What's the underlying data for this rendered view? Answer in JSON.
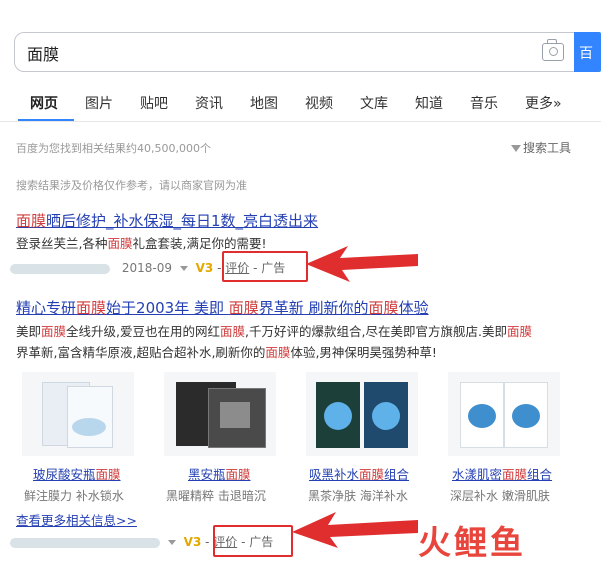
{
  "search": {
    "query": "面膜",
    "button": "百"
  },
  "tabs": [
    "网页",
    "图片",
    "贴吧",
    "资讯",
    "地图",
    "视频",
    "文库",
    "知道",
    "音乐",
    "更多»"
  ],
  "result_count": "百度为您找到相关结果约40,500,000个",
  "tools_label": "搜索工具",
  "notice": "搜索结果涉及价格仅作参考，请以商家官网为准",
  "result1": {
    "title": "面膜晒后修护_补水保湿_每日1数_亮白透出来",
    "title_parts": [
      "",
      "面膜",
      "晒后修护_补水保湿_每日1数_亮白透出来"
    ],
    "desc_parts": [
      "登录丝芙兰,各种",
      "面膜",
      "礼盒套装,满足你的需要!"
    ],
    "date": "2018-09",
    "v_badge": "V3",
    "eval": "评价",
    "ad": "- 广告"
  },
  "result2": {
    "title_parts": [
      "精心专研",
      "面膜",
      "始于2003年 美即 ",
      "面膜",
      "界革新 刷新你的",
      "面膜",
      "体验"
    ],
    "desc1_parts": [
      "美即",
      "面膜",
      "全线升级,爱豆也在用的网红",
      "面膜",
      ",千万好评的爆款组合,尽在美即官方旗舰店.美即",
      "面膜"
    ],
    "desc2_parts": [
      "界革新,富含精华原液,超贴合超补水,刷新你的",
      "面膜",
      "体验,男神保明昊强势种草!"
    ],
    "products": [
      {
        "name_parts": [
          "玻尿酸安瓶",
          "面膜"
        ],
        "sub": "鲜注膜力 补水锁水"
      },
      {
        "name_parts": [
          "黑安瓶",
          "面膜"
        ],
        "sub": "黑曜精粹 击退暗沉"
      },
      {
        "name_parts": [
          "吸黑补水",
          "面膜",
          "组合"
        ],
        "sub": "黑茶净肤 海洋补水"
      },
      {
        "name_parts": [
          "水漾肌密",
          "面膜",
          "组合"
        ],
        "sub": "深层补水 嫩滑肌肤"
      }
    ],
    "more": "查看更多相关信息>>",
    "v_badge": "V3",
    "eval": "评价",
    "ad": "- 广告"
  },
  "watermark": "火鲤鱼"
}
